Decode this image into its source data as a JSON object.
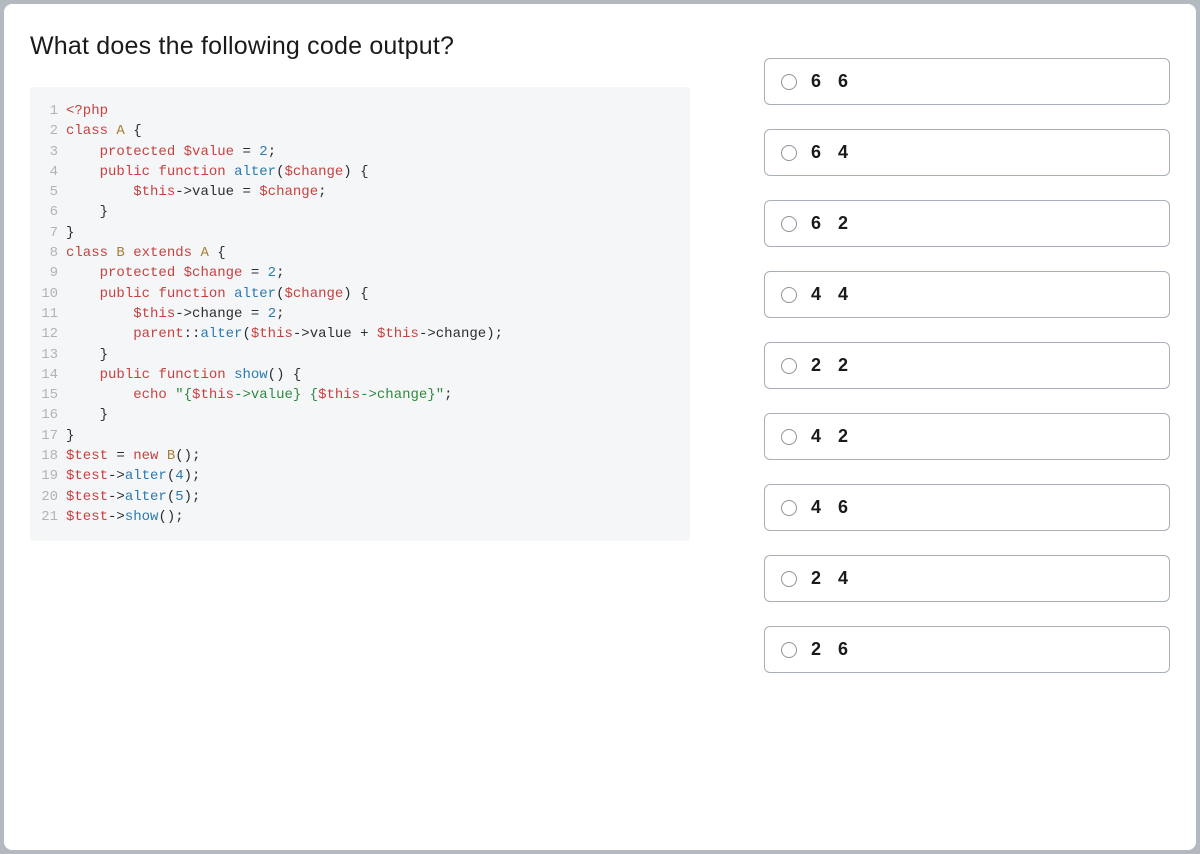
{
  "question": {
    "title": "What does the following code output?"
  },
  "code": {
    "lines": [
      {
        "n": "1",
        "tokens": [
          {
            "t": "<?php",
            "c": "t-tag"
          }
        ]
      },
      {
        "n": "2",
        "tokens": [
          {
            "t": "class",
            "c": "t-kw"
          },
          {
            "t": " "
          },
          {
            "t": "A",
            "c": "t-cls"
          },
          {
            "t": " {",
            "c": "t-punc"
          }
        ]
      },
      {
        "n": "3",
        "tokens": [
          {
            "t": "    "
          },
          {
            "t": "protected",
            "c": "t-kw"
          },
          {
            "t": " "
          },
          {
            "t": "$value",
            "c": "t-var"
          },
          {
            "t": " = ",
            "c": "t-op"
          },
          {
            "t": "2",
            "c": "t-num"
          },
          {
            "t": ";",
            "c": "t-punc"
          }
        ]
      },
      {
        "n": "4",
        "tokens": [
          {
            "t": "    "
          },
          {
            "t": "public",
            "c": "t-kw"
          },
          {
            "t": " "
          },
          {
            "t": "function",
            "c": "t-kw"
          },
          {
            "t": " "
          },
          {
            "t": "alter",
            "c": "t-fn"
          },
          {
            "t": "(",
            "c": "t-punc"
          },
          {
            "t": "$change",
            "c": "t-var"
          },
          {
            "t": ") {",
            "c": "t-punc"
          }
        ]
      },
      {
        "n": "5",
        "tokens": [
          {
            "t": "        "
          },
          {
            "t": "$this",
            "c": "t-var"
          },
          {
            "t": "->",
            "c": "t-op"
          },
          {
            "t": "value",
            "c": "t-op"
          },
          {
            "t": " = ",
            "c": "t-op"
          },
          {
            "t": "$change",
            "c": "t-var"
          },
          {
            "t": ";",
            "c": "t-punc"
          }
        ]
      },
      {
        "n": "6",
        "tokens": [
          {
            "t": "    }",
            "c": "t-punc"
          }
        ]
      },
      {
        "n": "7",
        "tokens": [
          {
            "t": "}",
            "c": "t-punc"
          }
        ]
      },
      {
        "n": "8",
        "tokens": [
          {
            "t": "class",
            "c": "t-kw"
          },
          {
            "t": " "
          },
          {
            "t": "B",
            "c": "t-cls"
          },
          {
            "t": " "
          },
          {
            "t": "extends",
            "c": "t-kw"
          },
          {
            "t": " "
          },
          {
            "t": "A",
            "c": "t-cls"
          },
          {
            "t": " {",
            "c": "t-punc"
          }
        ]
      },
      {
        "n": "9",
        "tokens": [
          {
            "t": "    "
          },
          {
            "t": "protected",
            "c": "t-kw"
          },
          {
            "t": " "
          },
          {
            "t": "$change",
            "c": "t-var"
          },
          {
            "t": " = ",
            "c": "t-op"
          },
          {
            "t": "2",
            "c": "t-num"
          },
          {
            "t": ";",
            "c": "t-punc"
          }
        ]
      },
      {
        "n": "10",
        "tokens": [
          {
            "t": "    "
          },
          {
            "t": "public",
            "c": "t-kw"
          },
          {
            "t": " "
          },
          {
            "t": "function",
            "c": "t-kw"
          },
          {
            "t": " "
          },
          {
            "t": "alter",
            "c": "t-fn"
          },
          {
            "t": "(",
            "c": "t-punc"
          },
          {
            "t": "$change",
            "c": "t-var"
          },
          {
            "t": ") {",
            "c": "t-punc"
          }
        ]
      },
      {
        "n": "11",
        "tokens": [
          {
            "t": "        "
          },
          {
            "t": "$this",
            "c": "t-var"
          },
          {
            "t": "->",
            "c": "t-op"
          },
          {
            "t": "change",
            "c": "t-op"
          },
          {
            "t": " = ",
            "c": "t-op"
          },
          {
            "t": "2",
            "c": "t-num"
          },
          {
            "t": ";",
            "c": "t-punc"
          }
        ]
      },
      {
        "n": "12",
        "tokens": [
          {
            "t": "        "
          },
          {
            "t": "parent",
            "c": "t-kw"
          },
          {
            "t": "::",
            "c": "t-op"
          },
          {
            "t": "alter",
            "c": "t-fn"
          },
          {
            "t": "(",
            "c": "t-punc"
          },
          {
            "t": "$this",
            "c": "t-var"
          },
          {
            "t": "->",
            "c": "t-op"
          },
          {
            "t": "value",
            "c": "t-op"
          },
          {
            "t": " + ",
            "c": "t-op"
          },
          {
            "t": "$this",
            "c": "t-var"
          },
          {
            "t": "->",
            "c": "t-op"
          },
          {
            "t": "change",
            "c": "t-op"
          },
          {
            "t": ");",
            "c": "t-punc"
          }
        ]
      },
      {
        "n": "13",
        "tokens": [
          {
            "t": "    }",
            "c": "t-punc"
          }
        ]
      },
      {
        "n": "14",
        "tokens": [
          {
            "t": "    "
          },
          {
            "t": "public",
            "c": "t-kw"
          },
          {
            "t": " "
          },
          {
            "t": "function",
            "c": "t-kw"
          },
          {
            "t": " "
          },
          {
            "t": "show",
            "c": "t-fn"
          },
          {
            "t": "() {",
            "c": "t-punc"
          }
        ]
      },
      {
        "n": "15",
        "tokens": [
          {
            "t": "        "
          },
          {
            "t": "echo",
            "c": "t-kw"
          },
          {
            "t": " "
          },
          {
            "t": "\"{",
            "c": "t-str"
          },
          {
            "t": "$this",
            "c": "t-var"
          },
          {
            "t": "->value} {",
            "c": "t-str"
          },
          {
            "t": "$this",
            "c": "t-var"
          },
          {
            "t": "->change}\"",
            "c": "t-str"
          },
          {
            "t": ";",
            "c": "t-punc"
          }
        ]
      },
      {
        "n": "16",
        "tokens": [
          {
            "t": "    }",
            "c": "t-punc"
          }
        ]
      },
      {
        "n": "17",
        "tokens": [
          {
            "t": "}",
            "c": "t-punc"
          }
        ]
      },
      {
        "n": "18",
        "tokens": [
          {
            "t": "$test",
            "c": "t-var"
          },
          {
            "t": " = ",
            "c": "t-op"
          },
          {
            "t": "new",
            "c": "t-kw"
          },
          {
            "t": " "
          },
          {
            "t": "B",
            "c": "t-cls"
          },
          {
            "t": "();",
            "c": "t-punc"
          }
        ]
      },
      {
        "n": "19",
        "tokens": [
          {
            "t": "$test",
            "c": "t-var"
          },
          {
            "t": "->",
            "c": "t-op"
          },
          {
            "t": "alter",
            "c": "t-fn"
          },
          {
            "t": "(",
            "c": "t-punc"
          },
          {
            "t": "4",
            "c": "t-num"
          },
          {
            "t": ");",
            "c": "t-punc"
          }
        ]
      },
      {
        "n": "20",
        "tokens": [
          {
            "t": "$test",
            "c": "t-var"
          },
          {
            "t": "->",
            "c": "t-op"
          },
          {
            "t": "alter",
            "c": "t-fn"
          },
          {
            "t": "(",
            "c": "t-punc"
          },
          {
            "t": "5",
            "c": "t-num"
          },
          {
            "t": ");",
            "c": "t-punc"
          }
        ]
      },
      {
        "n": "21",
        "tokens": [
          {
            "t": "$test",
            "c": "t-var"
          },
          {
            "t": "->",
            "c": "t-op"
          },
          {
            "t": "show",
            "c": "t-fn"
          },
          {
            "t": "();",
            "c": "t-punc"
          }
        ]
      }
    ]
  },
  "options": [
    {
      "label": "6 6"
    },
    {
      "label": "6 4"
    },
    {
      "label": "6 2"
    },
    {
      "label": "4 4"
    },
    {
      "label": "2 2"
    },
    {
      "label": "4 2"
    },
    {
      "label": "4 6"
    },
    {
      "label": "2 4"
    },
    {
      "label": "2 6"
    }
  ]
}
